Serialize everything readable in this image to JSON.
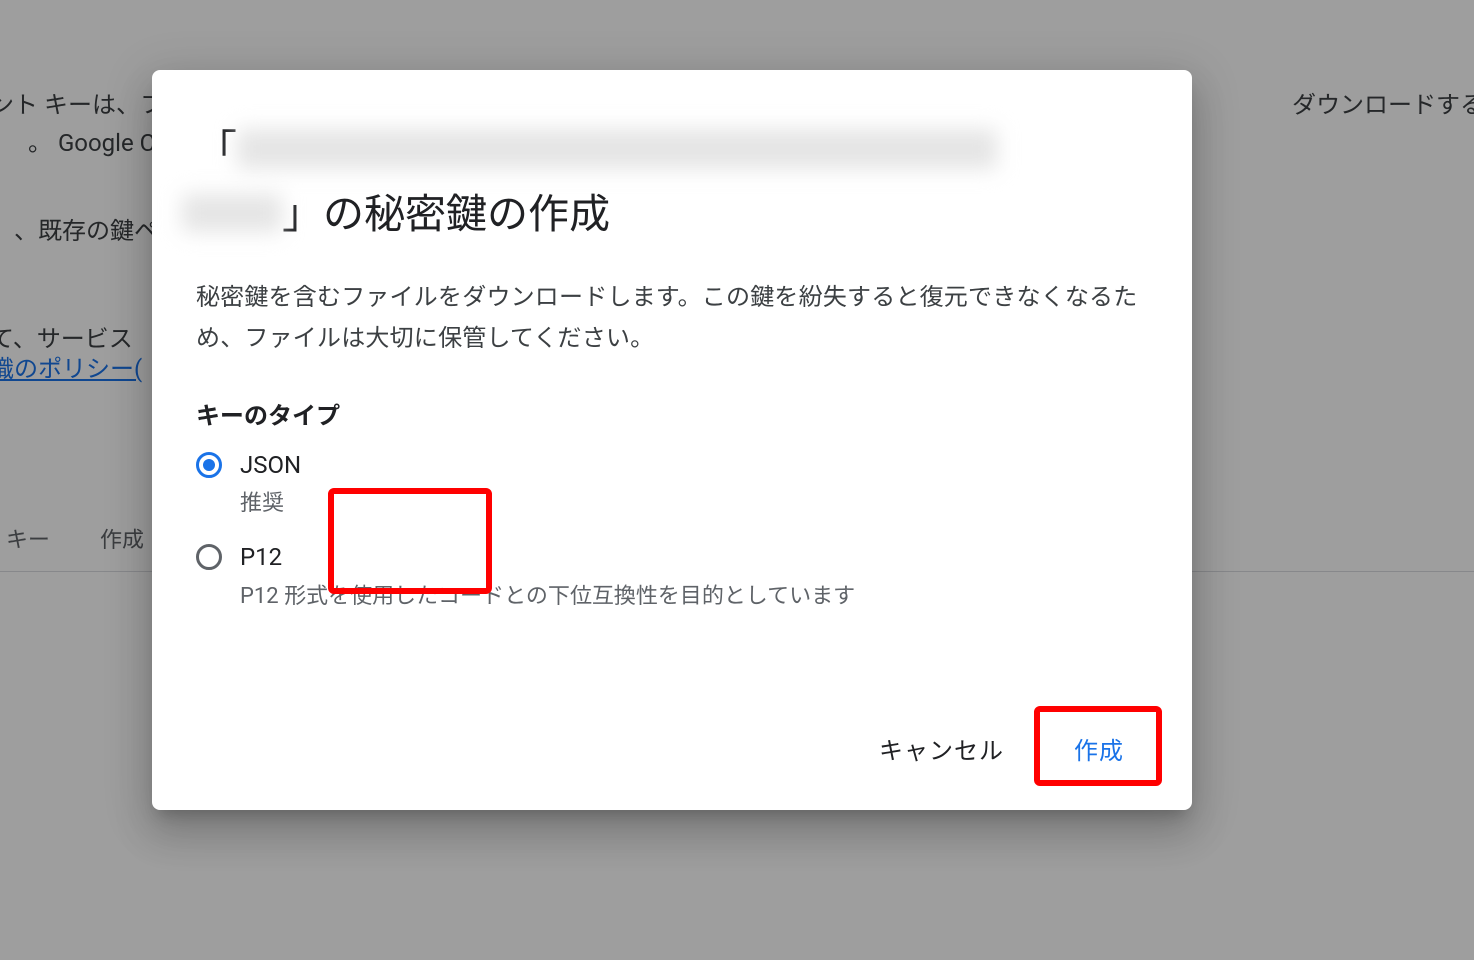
{
  "background": {
    "line1": "ント キーは、フ",
    "line2": "。 Google Cl",
    "line3": "、既存の鍵ペフ",
    "line4": "て、サービス",
    "link": "織のポリシー(",
    "right": "ダウンロードする",
    "tab1": "キー",
    "tab2": "作成"
  },
  "dialog": {
    "title_prefix": "「",
    "title_suffix": "」の秘密鍵の作成",
    "description": "秘密鍵を含むファイルをダウンロードします。この鍵を紛失すると復元できなくなるため、ファイルは大切に保管してください。",
    "key_type_label": "キーのタイプ",
    "options": [
      {
        "label": "JSON",
        "subtitle": "推奨",
        "selected": true
      },
      {
        "label": "P12",
        "subtitle": "P12 形式を使用したコードとの下位互換性を目的としています",
        "selected": false
      }
    ],
    "cancel_label": "キャンセル",
    "create_label": "作成"
  }
}
